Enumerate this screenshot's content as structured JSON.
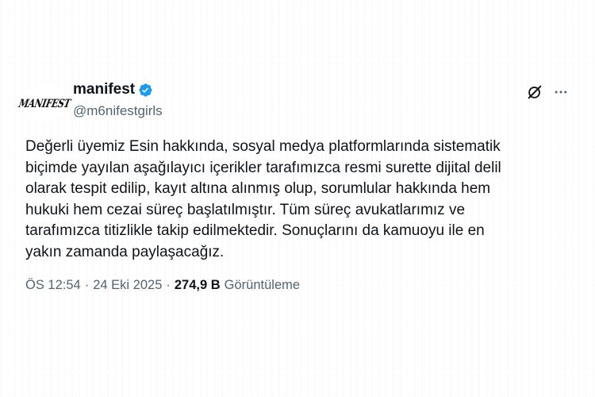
{
  "author": {
    "avatar_text": "MANIFEST",
    "display_name": "manifest",
    "handle": "@m6nifestgirls",
    "verified": true,
    "verified_color": "#1d9bf0"
  },
  "actions": {
    "grok_icon": "grok-icon",
    "more_icon": "more-icon"
  },
  "tweet": {
    "text": "Değerli üyemiz Esin hakkında, sosyal medya platformlarında sistematik\nbiçimde yayılan aşağılayıcı içerikler tarafımızca resmi surette dijital delil\nolarak tespit edilip, kayıt altına alınmış olup, sorumlular hakkında hem\nhukuki hem cezai süreç başlatılmıştır. Tüm süreç avukatlarımız ve\ntarafımızca titizlikle takip edilmektedir. Sonuçlarını da kamuoyu ile en\nyakın zamanda paylaşacağız."
  },
  "meta": {
    "time": "ÖS 12:54",
    "separator": "·",
    "date": "24 Eki 2025",
    "views_count": "274,9 B",
    "views_label": "Görüntüleme"
  }
}
